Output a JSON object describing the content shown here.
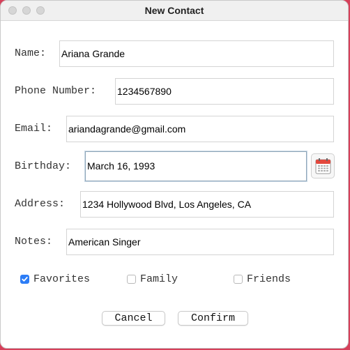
{
  "window": {
    "title": "New Contact"
  },
  "form": {
    "name": {
      "label": "Name:",
      "value": "Ariana Grande"
    },
    "phone": {
      "label": "Phone Number:",
      "value": "1234567890"
    },
    "email": {
      "label": "Email:",
      "value": "ariandagrande@gmail.com"
    },
    "birthday": {
      "label": "Birthday:",
      "value": "March 16, 1993"
    },
    "address": {
      "label": "Address:",
      "value": "1234 Hollywood Blvd, Los Angeles, CA"
    },
    "notes": {
      "label": "Notes:",
      "value": "American Singer"
    }
  },
  "groups": {
    "favorites": {
      "label": "Favorites",
      "checked": true
    },
    "family": {
      "label": "Family",
      "checked": false
    },
    "friends": {
      "label": "Friends",
      "checked": false
    }
  },
  "buttons": {
    "cancel": "Cancel",
    "confirm": "Confirm"
  },
  "icons": {
    "calendar": "calendar-icon",
    "checkmark": "checkmark-icon"
  },
  "colors": {
    "accent": "#2c7df6",
    "desktop": "#d6405a"
  }
}
